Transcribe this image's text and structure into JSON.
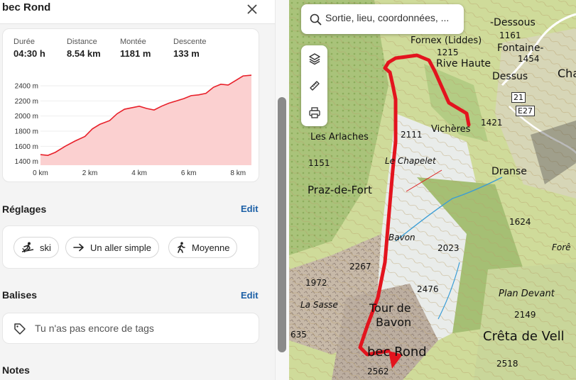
{
  "panel": {
    "title": "bec Rond",
    "stats": [
      {
        "label": "Durée",
        "value": "04:30 h"
      },
      {
        "label": "Distance",
        "value": "8.54 km"
      },
      {
        "label": "Montée",
        "value": "1181 m"
      },
      {
        "label": "Descente",
        "value": "133 m"
      }
    ],
    "settings": {
      "title": "Réglages",
      "edit": "Edit",
      "chips": [
        {
          "icon": "skier-icon",
          "label": "ski"
        },
        {
          "icon": "arrow-right-icon",
          "label": "Un aller simple"
        },
        {
          "icon": "hiker-icon",
          "label": "Moyenne"
        }
      ]
    },
    "tags": {
      "title": "Balises",
      "edit": "Edit",
      "empty": "Tu n'as pas encore de tags",
      "icon": "tag-icon"
    },
    "notes": {
      "title": "Notes"
    }
  },
  "chart_data": {
    "type": "area",
    "xlabel": "",
    "ylabel": "",
    "x_unit": "km",
    "y_unit": "m",
    "xlim": [
      0,
      8.54
    ],
    "ylim": [
      1350,
      2550
    ],
    "x_ticks": [
      "0 km",
      "2 km",
      "4 km",
      "6 km",
      "8 km"
    ],
    "y_ticks": [
      "1400 m",
      "1600 m",
      "1800 m",
      "2000 m",
      "2200 m",
      "2400 m"
    ],
    "color": "#e8202a",
    "fill": "#fbd0d0",
    "x": [
      0,
      0.3,
      0.6,
      1.0,
      1.4,
      1.8,
      2.1,
      2.4,
      2.8,
      3.1,
      3.4,
      3.7,
      4.0,
      4.3,
      4.6,
      4.9,
      5.2,
      5.5,
      5.8,
      6.1,
      6.4,
      6.7,
      7.0,
      7.3,
      7.6,
      7.9,
      8.2,
      8.54
    ],
    "y": [
      1490,
      1480,
      1520,
      1600,
      1670,
      1730,
      1830,
      1890,
      1940,
      2030,
      2090,
      2110,
      2130,
      2100,
      2080,
      2130,
      2170,
      2200,
      2230,
      2270,
      2280,
      2300,
      2380,
      2420,
      2410,
      2470,
      2530,
      2540
    ]
  },
  "map": {
    "search_placeholder": "Sortie, lieu, coordonnées, ...",
    "tools": [
      "layers-icon",
      "ruler-icon",
      "print-icon"
    ],
    "labels": [
      {
        "text": "-Dessous",
        "size": 14
      },
      {
        "text": "1161",
        "size": 12
      },
      {
        "text": "Fontaine-",
        "size": 14
      },
      {
        "text": "1454",
        "size": 12
      },
      {
        "text": "Dessus",
        "size": 14
      },
      {
        "text": "Cha",
        "size": 16
      },
      {
        "text": "Fornex (Liddes)",
        "size": 13
      },
      {
        "text": "1215",
        "size": 12
      },
      {
        "text": "Rive Haute",
        "size": 14
      },
      {
        "text": "21",
        "size": 11
      },
      {
        "text": "E27",
        "size": 11
      },
      {
        "text": "Vichères",
        "size": 13
      },
      {
        "text": "1421",
        "size": 12
      },
      {
        "text": "Les Arlaches",
        "size": 13
      },
      {
        "text": "2111",
        "size": 12
      },
      {
        "text": "1151",
        "size": 12
      },
      {
        "text": "Le Chapelet",
        "size": 12
      },
      {
        "text": "Dranse",
        "size": 14
      },
      {
        "text": "Praz-de-Fort",
        "size": 15
      },
      {
        "text": "1624",
        "size": 12
      },
      {
        "text": "Bavon",
        "size": 12
      },
      {
        "text": "2023",
        "size": 12
      },
      {
        "text": "Forê",
        "size": 12
      },
      {
        "text": "2267",
        "size": 12
      },
      {
        "text": "1972",
        "size": 12
      },
      {
        "text": "2476",
        "size": 12
      },
      {
        "text": "Plan Devant",
        "size": 13
      },
      {
        "text": "La Sasse",
        "size": 12
      },
      {
        "text": "Tour de",
        "size": 16
      },
      {
        "text": "Bavon",
        "size": 16
      },
      {
        "text": "2149",
        "size": 12
      },
      {
        "text": "Crêta de Vell",
        "size": 18
      },
      {
        "text": "635",
        "size": 12
      },
      {
        "text": "bec Rond",
        "size": 18
      },
      {
        "text": "2518",
        "size": 12
      },
      {
        "text": "2562",
        "size": 12
      }
    ]
  }
}
